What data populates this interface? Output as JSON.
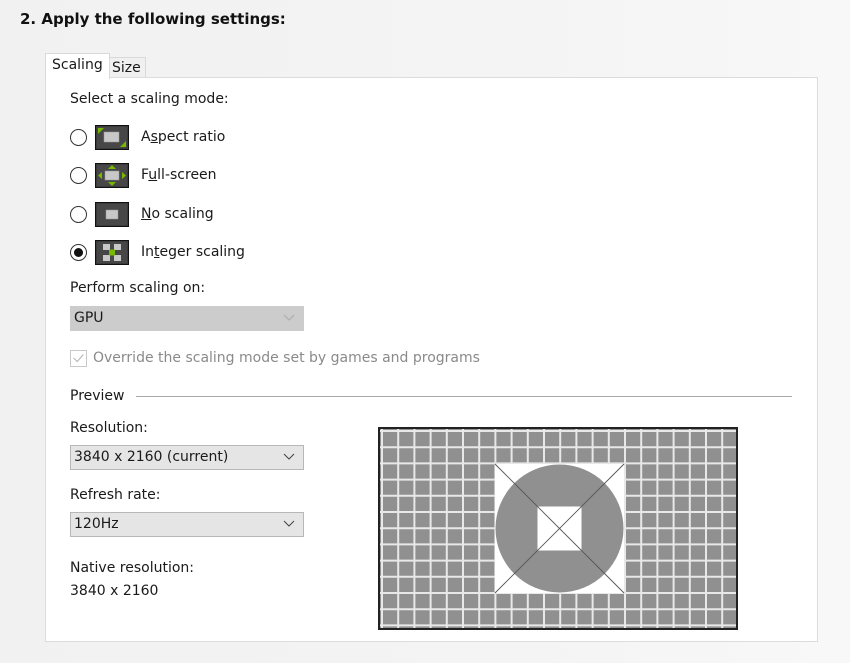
{
  "heading": "2. Apply the following settings:",
  "tabs": [
    {
      "label": "Scaling",
      "active": true
    },
    {
      "label": "Size",
      "active": false
    }
  ],
  "scaling": {
    "section_label": "Select a scaling mode:",
    "modes": [
      {
        "label_pre": "A",
        "label_u": "s",
        "label_post": "pect ratio",
        "icon": "aspect-ratio-icon",
        "selected": false
      },
      {
        "label_pre": "F",
        "label_u": "u",
        "label_post": "ll-screen",
        "icon": "full-screen-icon",
        "selected": false
      },
      {
        "label_pre": "",
        "label_u": "N",
        "label_post": "o scaling",
        "icon": "no-scaling-icon",
        "selected": false
      },
      {
        "label_pre": "In",
        "label_u": "t",
        "label_post": "eger scaling",
        "icon": "integer-scaling-icon",
        "selected": true
      }
    ],
    "perform_label": "Perform scaling on:",
    "perform_value": "GPU",
    "override_label": "Override the scaling mode set by games and programs",
    "override_checked": true
  },
  "preview": {
    "section_label": "Preview",
    "resolution_label": "Resolution:",
    "resolution_value": "3840 x 2160 (current)",
    "refresh_label": "Refresh rate:",
    "refresh_value": "120Hz",
    "native_label": "Native resolution:",
    "native_value": "3840 x 2160"
  },
  "colors": {
    "accent_green": "#76b900",
    "grid_gray": "#909090"
  }
}
